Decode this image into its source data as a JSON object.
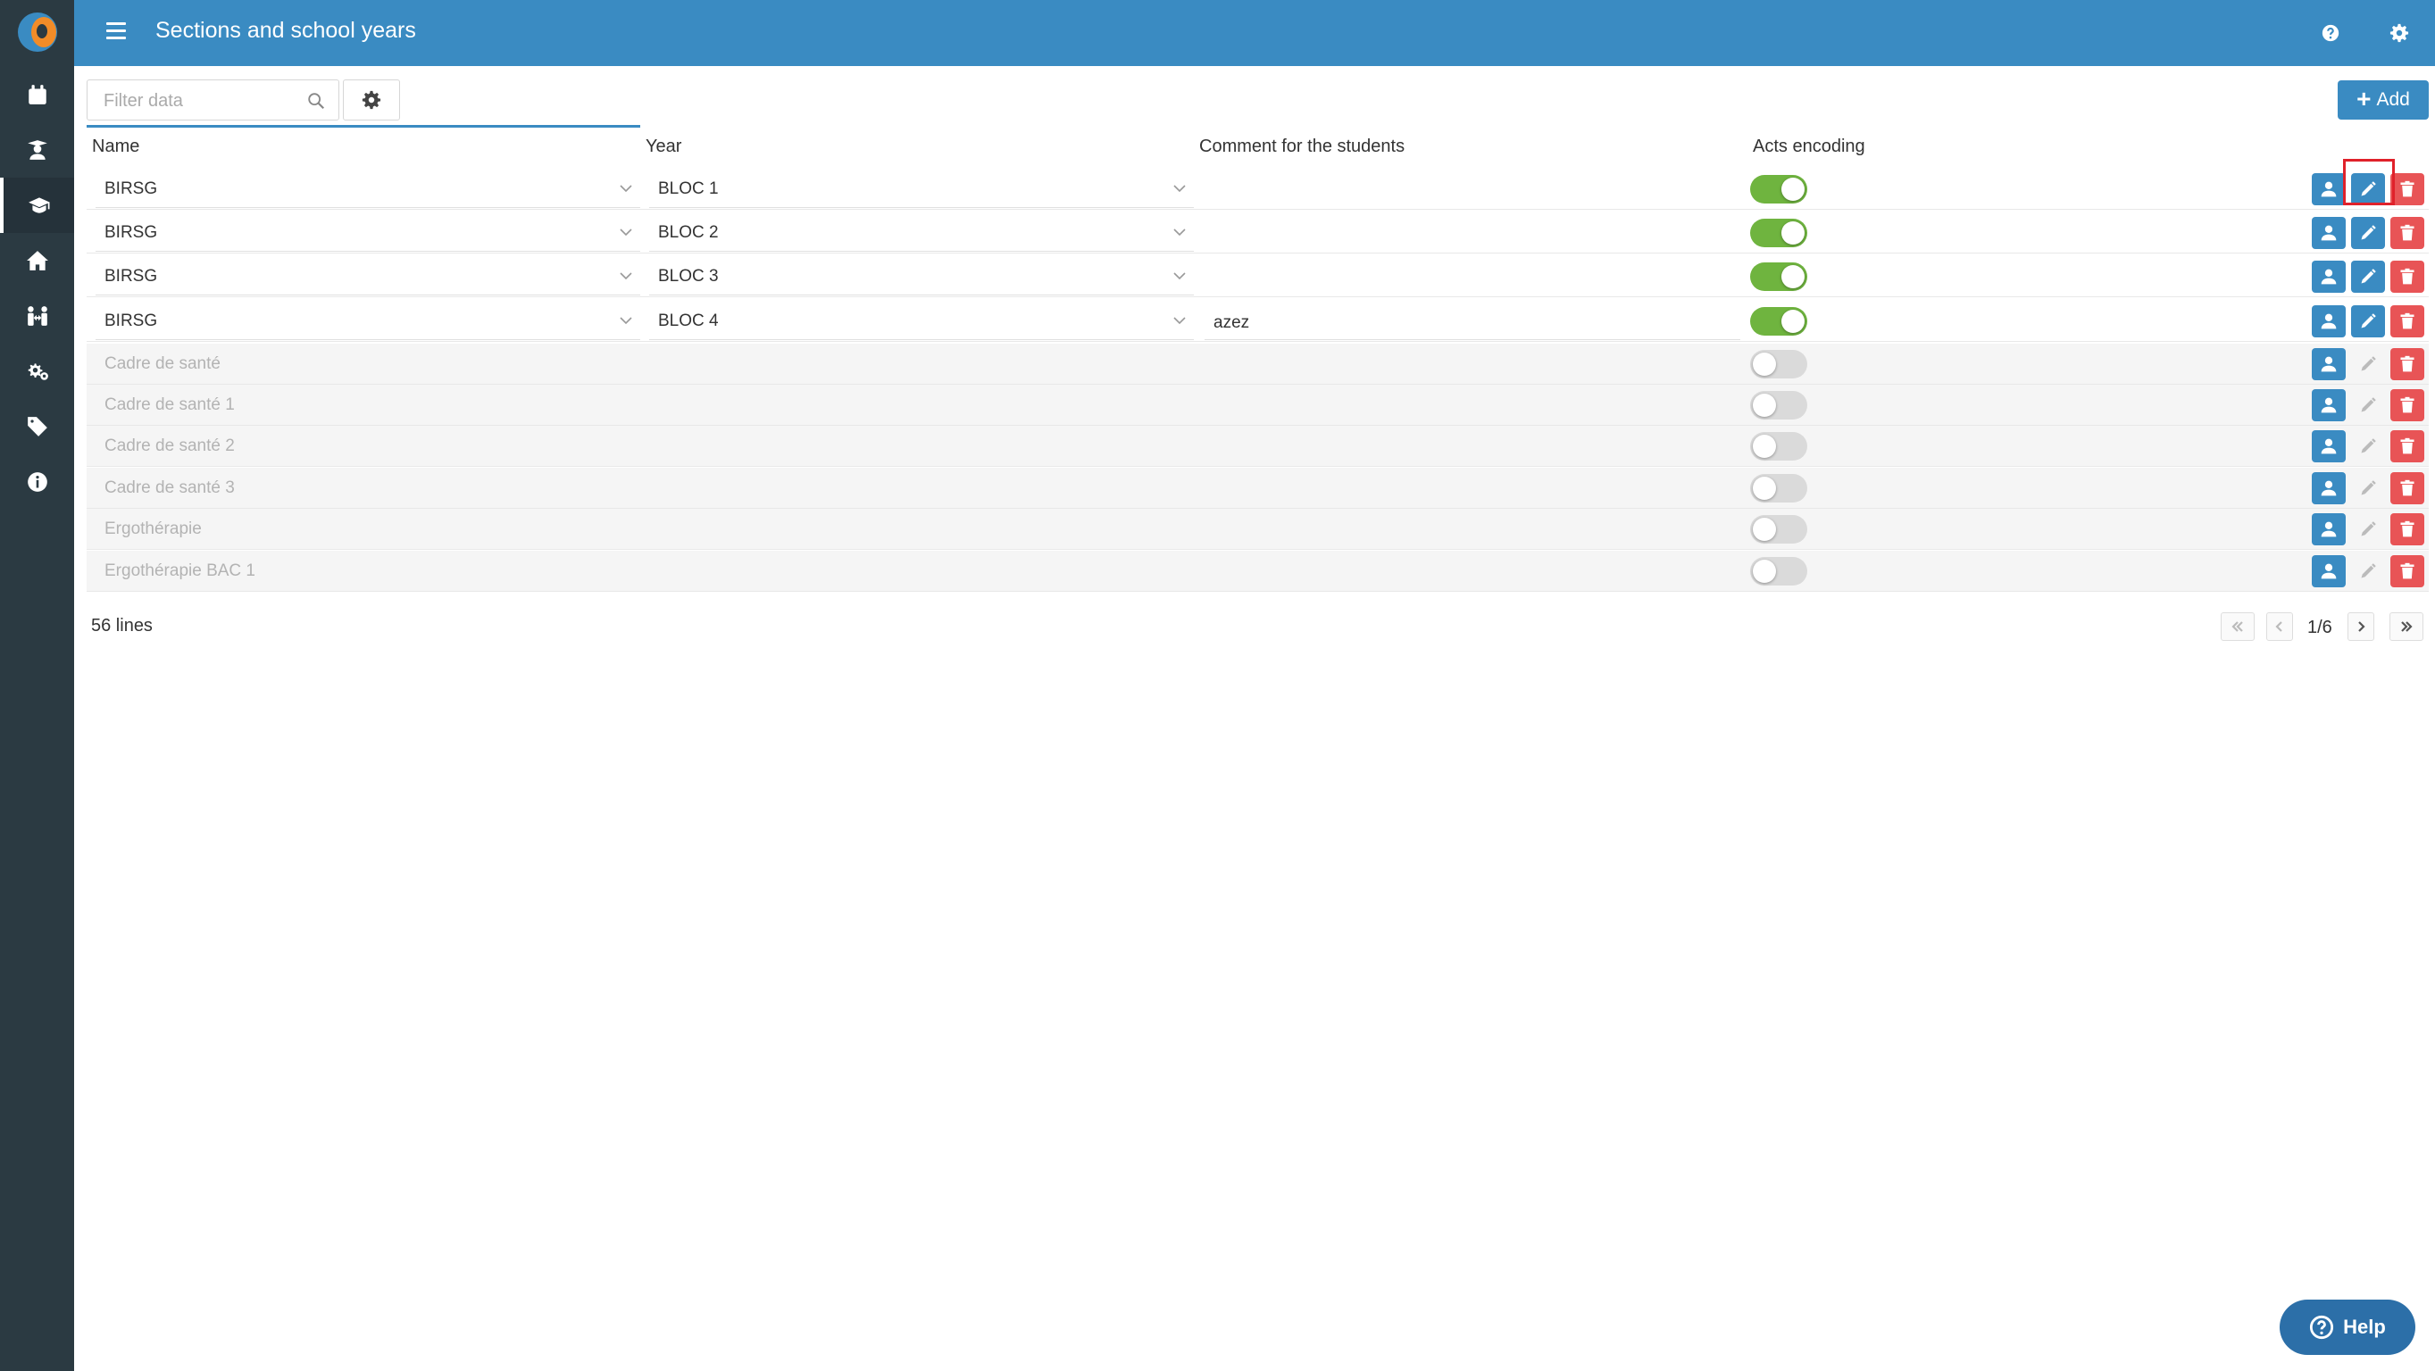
{
  "header": {
    "title": "Sections and school years"
  },
  "toolbar": {
    "filter_placeholder": "Filter data",
    "add_label": "Add"
  },
  "table": {
    "columns": [
      "Name",
      "Year",
      "Comment for the students",
      "Acts encoding"
    ],
    "rows": [
      {
        "name": "BIRSG",
        "year": "BLOC 1",
        "comment": "",
        "acts_encoding": true,
        "enabled": true
      },
      {
        "name": "BIRSG",
        "year": "BLOC 2",
        "comment": "",
        "acts_encoding": true,
        "enabled": true
      },
      {
        "name": "BIRSG",
        "year": "BLOC 3",
        "comment": "",
        "acts_encoding": true,
        "enabled": true
      },
      {
        "name": "BIRSG",
        "year": "BLOC 4",
        "comment": "azez",
        "acts_encoding": true,
        "enabled": true
      },
      {
        "name": "Cadre de santé",
        "year": "",
        "comment": "",
        "acts_encoding": false,
        "enabled": false
      },
      {
        "name": "Cadre de santé 1",
        "year": "",
        "comment": "",
        "acts_encoding": false,
        "enabled": false
      },
      {
        "name": "Cadre de santé 2",
        "year": "",
        "comment": "",
        "acts_encoding": false,
        "enabled": false
      },
      {
        "name": "Cadre de santé 3",
        "year": "",
        "comment": "",
        "acts_encoding": false,
        "enabled": false
      },
      {
        "name": "Ergothérapie",
        "year": "",
        "comment": "",
        "acts_encoding": false,
        "enabled": false
      },
      {
        "name": "Ergothérapie BAC 1",
        "year": "",
        "comment": "",
        "acts_encoding": false,
        "enabled": false
      }
    ]
  },
  "footer": {
    "line_count": "56 lines",
    "page": "1/6"
  },
  "help": {
    "label": "Help"
  },
  "sidebar": {
    "items": [
      {
        "icon": "calendar-icon"
      },
      {
        "icon": "student-icon"
      },
      {
        "icon": "graduation-cap-icon",
        "active": true
      },
      {
        "icon": "home-icon"
      },
      {
        "icon": "people-arrows-icon"
      },
      {
        "icon": "gears-icon"
      },
      {
        "icon": "tags-icon"
      },
      {
        "icon": "info-icon"
      }
    ]
  },
  "colors": {
    "primary": "#3a8bc2",
    "sidebar": "#2b3a42",
    "toggle_on": "#6fb43f",
    "danger": "#e85456",
    "highlight": "#e0212a"
  }
}
